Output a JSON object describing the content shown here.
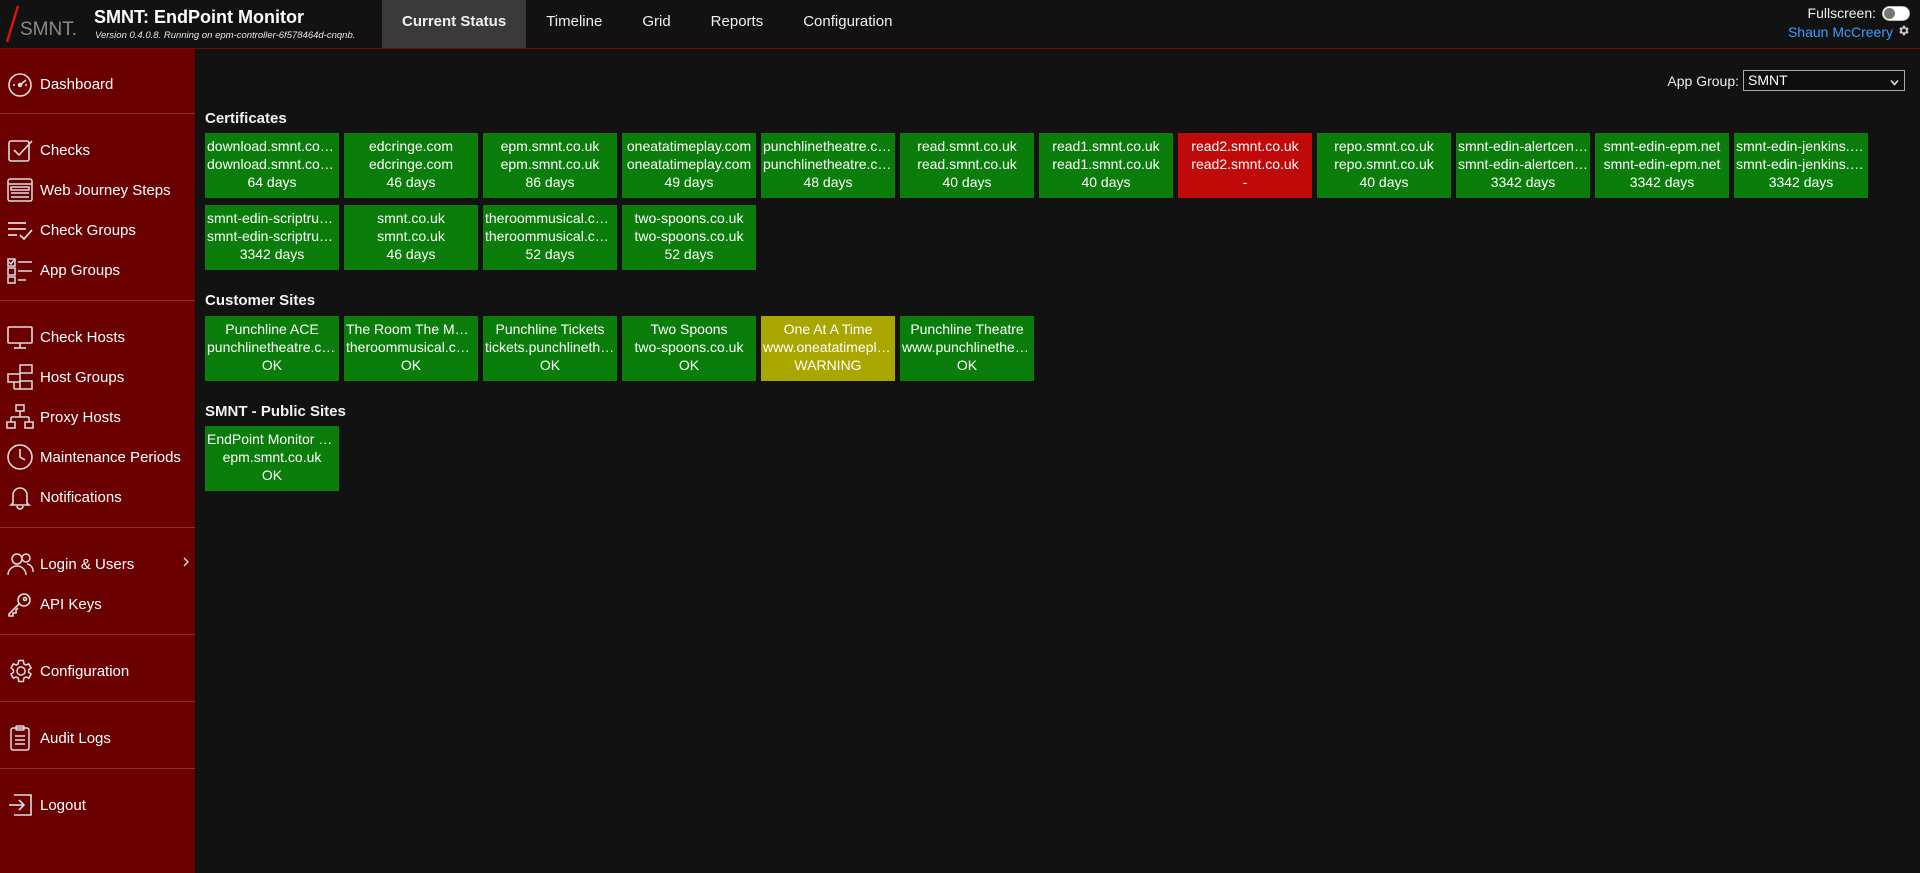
{
  "header": {
    "logo_text": "SMNT.",
    "title": "SMNT: EndPoint Monitor",
    "version": "Version 0.4.0.8. Running on epm-controller-6f578464d-cnqnb.",
    "tabs": [
      {
        "label": "Current Status",
        "active": true
      },
      {
        "label": "Timeline",
        "active": false
      },
      {
        "label": "Grid",
        "active": false
      },
      {
        "label": "Reports",
        "active": false
      },
      {
        "label": "Configuration",
        "active": false
      }
    ],
    "fullscreen_label": "Fullscreen:",
    "fullscreen_on": false,
    "user_name": "Shaun McCreery"
  },
  "sidebar": {
    "items": [
      {
        "label": "Dashboard",
        "icon": "dashboard-icon"
      },
      {
        "label": "Checks",
        "icon": "checks-icon"
      },
      {
        "label": "Web Journey Steps",
        "icon": "web-journey-icon"
      },
      {
        "label": "Check Groups",
        "icon": "check-groups-icon"
      },
      {
        "label": "App Groups",
        "icon": "app-groups-icon"
      },
      {
        "label": "Check Hosts",
        "icon": "monitor-icon"
      },
      {
        "label": "Host Groups",
        "icon": "host-groups-icon"
      },
      {
        "label": "Proxy Hosts",
        "icon": "network-icon"
      },
      {
        "label": "Maintenance Periods",
        "icon": "clock-icon"
      },
      {
        "label": "Notifications",
        "icon": "bell-icon"
      },
      {
        "label": "Login & Users",
        "icon": "users-icon"
      },
      {
        "label": "API Keys",
        "icon": "key-icon"
      },
      {
        "label": "Configuration",
        "icon": "gear-icon"
      },
      {
        "label": "Audit Logs",
        "icon": "clipboard-icon"
      },
      {
        "label": "Logout",
        "icon": "logout-icon"
      }
    ]
  },
  "main": {
    "app_group_label": "App Group:",
    "app_group_value": "SMNT",
    "sections": [
      {
        "title": "Certificates",
        "tiles": [
          {
            "l1": "download.smnt.co.uk",
            "l2": "download.smnt.co.uk",
            "l3": "64 days",
            "status": "ok"
          },
          {
            "l1": "edcringe.com",
            "l2": "edcringe.com",
            "l3": "46 days",
            "status": "ok"
          },
          {
            "l1": "epm.smnt.co.uk",
            "l2": "epm.smnt.co.uk",
            "l3": "86 days",
            "status": "ok"
          },
          {
            "l1": "oneatatimeplay.com",
            "l2": "oneatatimeplay.com",
            "l3": "49 days",
            "status": "ok"
          },
          {
            "l1": "punchlinetheatre.co.uk",
            "l2": "punchlinetheatre.co.uk",
            "l3": "48 days",
            "status": "ok"
          },
          {
            "l1": "read.smnt.co.uk",
            "l2": "read.smnt.co.uk",
            "l3": "40 days",
            "status": "ok"
          },
          {
            "l1": "read1.smnt.co.uk",
            "l2": "read1.smnt.co.uk",
            "l3": "40 days",
            "status": "ok"
          },
          {
            "l1": "read2.smnt.co.uk",
            "l2": "read2.smnt.co.uk",
            "l3": "-",
            "status": "err"
          },
          {
            "l1": "repo.smnt.co.uk",
            "l2": "repo.smnt.co.uk",
            "l3": "40 days",
            "status": "ok"
          },
          {
            "l1": "smnt-edin-alertcentre",
            "l2": "smnt-edin-alertcentre",
            "l3": "3342 days",
            "status": "ok"
          },
          {
            "l1": "smnt-edin-epm.net",
            "l2": "smnt-edin-epm.net",
            "l3": "3342 days",
            "status": "ok"
          },
          {
            "l1": "smnt-edin-jenkins.net",
            "l2": "smnt-edin-jenkins.net",
            "l3": "3342 days",
            "status": "ok"
          },
          {
            "l1": "smnt-edin-scriptrunner",
            "l2": "smnt-edin-scriptrunner",
            "l3": "3342 days",
            "status": "ok"
          },
          {
            "l1": "smnt.co.uk",
            "l2": "smnt.co.uk",
            "l3": "46 days",
            "status": "ok"
          },
          {
            "l1": "theroommusical.co.uk",
            "l2": "theroommusical.co.uk",
            "l3": "52 days",
            "status": "ok"
          },
          {
            "l1": "two-spoons.co.uk",
            "l2": "two-spoons.co.uk",
            "l3": "52 days",
            "status": "ok"
          }
        ]
      },
      {
        "title": "Customer Sites",
        "tiles": [
          {
            "l1": "Punchline ACE",
            "l2": "punchlinetheatre.co.uk",
            "l3": "OK",
            "status": "ok"
          },
          {
            "l1": "The Room The Musical",
            "l2": "theroommusical.co.uk",
            "l3": "OK",
            "status": "ok"
          },
          {
            "l1": "Punchline Tickets",
            "l2": "tickets.punchlinetheatre",
            "l3": "OK",
            "status": "ok"
          },
          {
            "l1": "Two Spoons",
            "l2": "two-spoons.co.uk",
            "l3": "OK",
            "status": "ok"
          },
          {
            "l1": "One At A Time",
            "l2": "www.oneatatimeplay.com",
            "l3": "WARNING",
            "status": "warn"
          },
          {
            "l1": "Punchline Theatre",
            "l2": "www.punchlinetheatre.co.uk",
            "l3": "OK",
            "status": "ok"
          }
        ]
      },
      {
        "title": "SMNT - Public Sites",
        "tiles": [
          {
            "l1": "EndPoint Monitor Site",
            "l2": "epm.smnt.co.uk",
            "l3": "OK",
            "status": "ok"
          }
        ]
      }
    ]
  }
}
